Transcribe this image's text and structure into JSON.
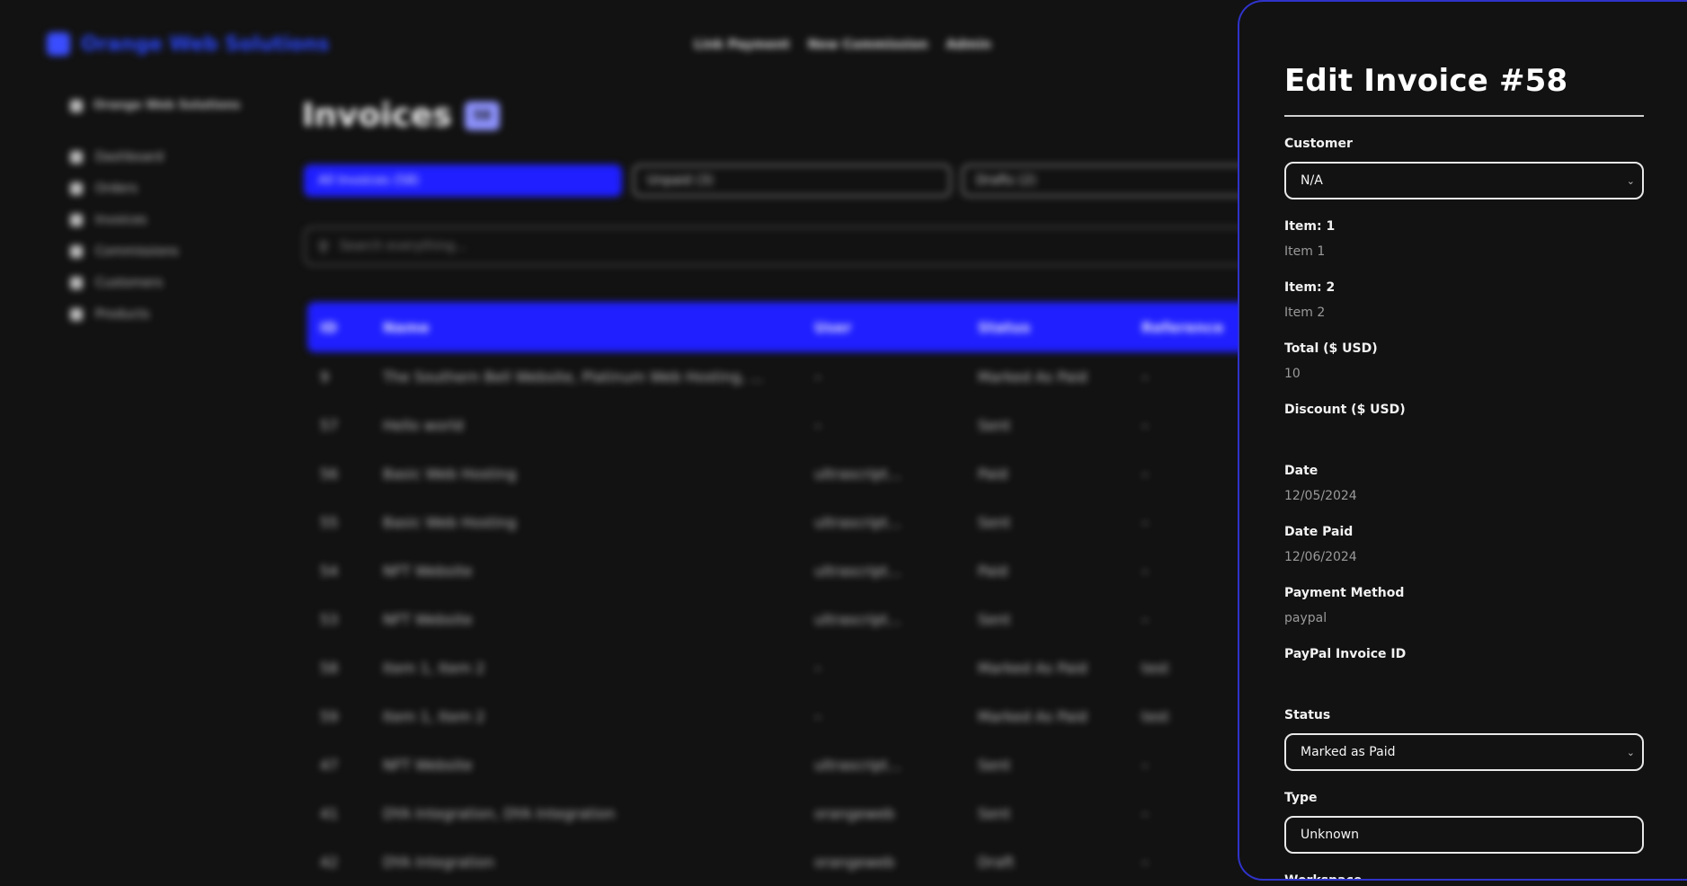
{
  "app": {
    "brand": "Orange Web Solutions",
    "topnav": [
      "Link Payment",
      "New Commission",
      "Admin"
    ],
    "sidebar": {
      "workspace": "Orange Web Solutions",
      "items": [
        "Dashboard",
        "Orders",
        "Invoices",
        "Commissions",
        "Customers",
        "Products"
      ]
    },
    "page_title": "Invoices",
    "count_badge": "58",
    "filters": [
      "All Invoices (58)",
      "Unpaid (3)",
      "Drafts (2)"
    ],
    "search_placeholder": "Search everything...",
    "table": {
      "headers": [
        "ID",
        "Name",
        "User",
        "Status",
        "Reference"
      ],
      "rows": [
        [
          "9",
          "The Southern Bell Website, Platinum Web Hosting, ...",
          "–",
          "Marked As Paid",
          "–"
        ],
        [
          "57",
          "Hello world",
          "–",
          "Sent",
          "–"
        ],
        [
          "56",
          "Basic Web Hosting",
          "ultrascript...",
          "Paid",
          "–"
        ],
        [
          "55",
          "Basic Web Hosting",
          "ultrascript...",
          "Sent",
          "–"
        ],
        [
          "54",
          "NFT Website",
          "ultrascript...",
          "Paid",
          "–"
        ],
        [
          "53",
          "NFT Website",
          "ultrascript...",
          "Sent",
          "–"
        ],
        [
          "58",
          "Item 1, Item 2",
          "–",
          "Marked As Paid",
          "test"
        ],
        [
          "59",
          "Item 1, Item 2",
          "–",
          "Marked As Paid",
          "test"
        ],
        [
          "47",
          "NFT Website",
          "ultrascript...",
          "Sent",
          "–"
        ],
        [
          "41",
          "DYA Integration, DYA Integration",
          "orangeweb",
          "Sent",
          "–"
        ],
        [
          "42",
          "DYA Integration",
          "orangeweb",
          "Draft",
          "–"
        ]
      ]
    }
  },
  "panel": {
    "title": "Edit Invoice #58",
    "customer_label": "Customer",
    "customer_value": "N/A",
    "item1_label": "Item: 1",
    "item1_value": "Item 1",
    "item2_label": "Item: 2",
    "item2_value": "Item 2",
    "total_label": "Total ($ USD)",
    "total_value": "10",
    "discount_label": "Discount ($ USD)",
    "discount_value": "",
    "date_label": "Date",
    "date_value": "12/05/2024",
    "date_paid_label": "Date Paid",
    "date_paid_value": "12/06/2024",
    "payment_method_label": "Payment Method",
    "payment_method_value": "paypal",
    "paypal_id_label": "PayPal Invoice ID",
    "paypal_id_value": "",
    "status_label": "Status",
    "status_value": "Marked as Paid",
    "type_label": "Type",
    "type_value": "Unknown",
    "workspace_label": "Workspace"
  },
  "colors": {
    "background": "#121212",
    "accent_blue": "#1f1fff",
    "panel_border": "#2f33c9"
  }
}
